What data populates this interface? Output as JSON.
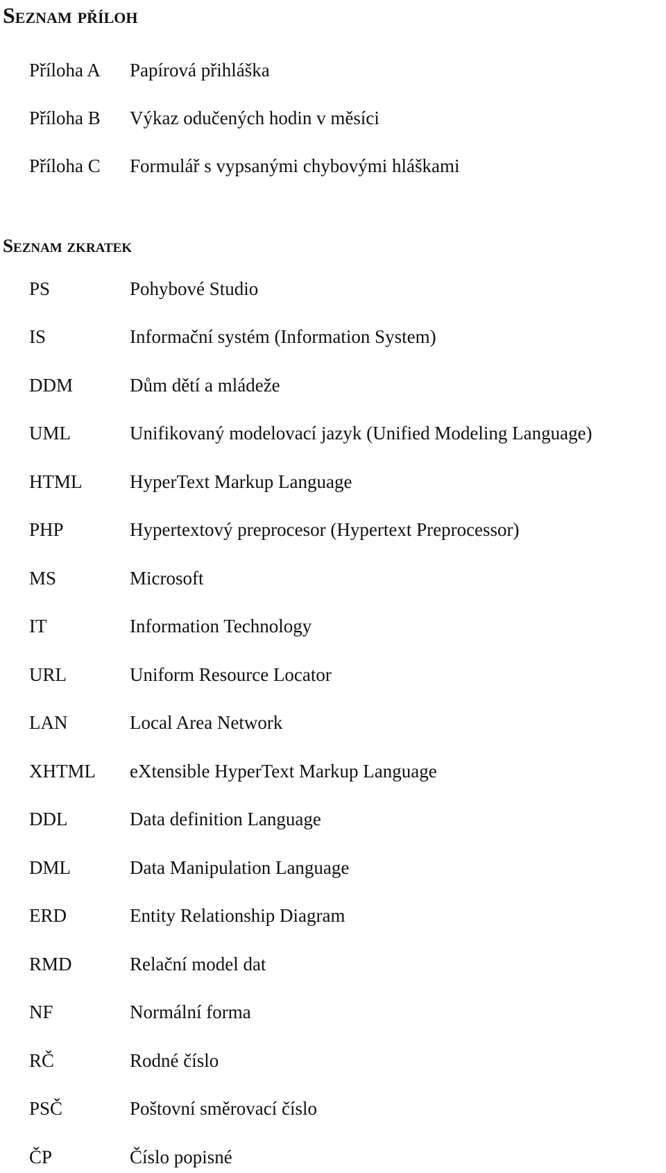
{
  "attachments": {
    "title": "Seznam příloh",
    "items": [
      {
        "key": "Příloha A",
        "value": "Papírová přihláška"
      },
      {
        "key": "Příloha B",
        "value": "Výkaz odučených hodin v měsíci"
      },
      {
        "key": "Příloha C",
        "value": "Formulář s vypsanými chybovými hláškami"
      }
    ]
  },
  "abbreviations": {
    "title": "Seznam zkratek",
    "items": [
      {
        "key": "PS",
        "value": "Pohybové Studio"
      },
      {
        "key": "IS",
        "value": "Informační systém (Information System)"
      },
      {
        "key": "DDM",
        "value": "Dům dětí a mládeže"
      },
      {
        "key": "UML",
        "value": "Unifikovaný modelovací jazyk (Unified Modeling Language)"
      },
      {
        "key": "HTML",
        "value": "HyperText Markup Language"
      },
      {
        "key": "PHP",
        "value": "Hypertextový preprocesor (Hypertext Preprocessor)"
      },
      {
        "key": "MS",
        "value": "Microsoft"
      },
      {
        "key": "IT",
        "value": "Information Technology"
      },
      {
        "key": "URL",
        "value": "Uniform Resource Locator"
      },
      {
        "key": "LAN",
        "value": "Local Area Network"
      },
      {
        "key": "XHTML",
        "value": "eXtensible HyperText Markup Language"
      },
      {
        "key": "DDL",
        "value": "Data definition Language"
      },
      {
        "key": "DML",
        "value": "Data Manipulation Language"
      },
      {
        "key": "ERD",
        "value": "Entity Relationship Diagram"
      },
      {
        "key": "RMD",
        "value": "Relační model dat"
      },
      {
        "key": "NF",
        "value": "Normální forma"
      },
      {
        "key": "RČ",
        "value": "Rodné číslo"
      },
      {
        "key": "PSČ",
        "value": "Poštovní směrovací číslo"
      },
      {
        "key": "ČP",
        "value": "Číslo popisné"
      }
    ]
  }
}
